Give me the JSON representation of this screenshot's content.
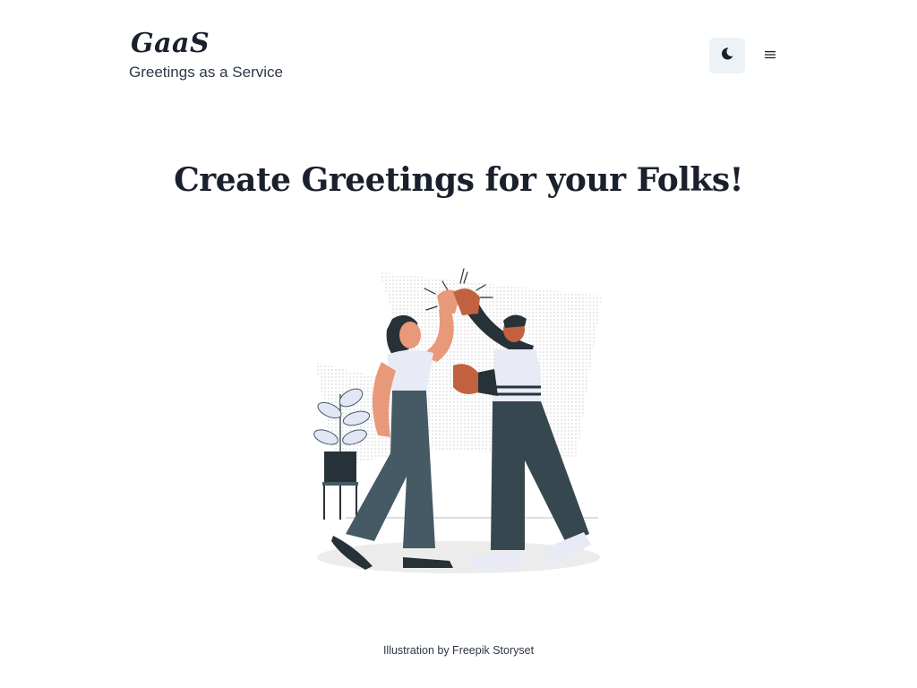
{
  "header": {
    "brand_title": "GaaS",
    "brand_subtitle": "Greetings as a Service",
    "theme_toggle_icon": "moon-icon",
    "menu_icon": "hamburger-menu-icon"
  },
  "main": {
    "title": "Create Greetings for your Folks!",
    "illustration_icon": "high-five-illustration"
  },
  "footer": {
    "credit": "Illustration by Freepik Storyset"
  },
  "colors": {
    "text": "#1a202c",
    "toggle_bg": "#edf2f7",
    "skin_light": "#e8997a",
    "skin_dark": "#c2613f",
    "pants": "#455a64",
    "shirt": "#e8eaf6",
    "dark": "#263238"
  }
}
